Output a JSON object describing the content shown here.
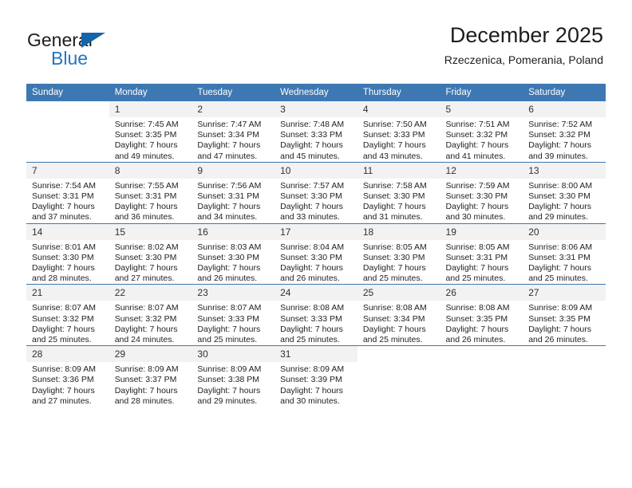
{
  "brand": {
    "name_part1": "General",
    "name_part2": "Blue",
    "triangle_color": "#1464aa",
    "blue_color": "#1f77c4"
  },
  "header": {
    "title": "December 2025",
    "subtitle": "Rzeczenica, Pomerania, Poland"
  },
  "theme": {
    "header_bg": "#3d78b2",
    "daynum_bg": "#f2f2f2",
    "text": "#222222"
  },
  "weekday_headers": [
    "Sunday",
    "Monday",
    "Tuesday",
    "Wednesday",
    "Thursday",
    "Friday",
    "Saturday"
  ],
  "weeks": [
    {
      "days": [
        {
          "num": "",
          "sunrise": "",
          "sunset": "",
          "daylight1": "",
          "daylight2": ""
        },
        {
          "num": "1",
          "sunrise": "Sunrise: 7:45 AM",
          "sunset": "Sunset: 3:35 PM",
          "daylight1": "Daylight: 7 hours",
          "daylight2": "and 49 minutes."
        },
        {
          "num": "2",
          "sunrise": "Sunrise: 7:47 AM",
          "sunset": "Sunset: 3:34 PM",
          "daylight1": "Daylight: 7 hours",
          "daylight2": "and 47 minutes."
        },
        {
          "num": "3",
          "sunrise": "Sunrise: 7:48 AM",
          "sunset": "Sunset: 3:33 PM",
          "daylight1": "Daylight: 7 hours",
          "daylight2": "and 45 minutes."
        },
        {
          "num": "4",
          "sunrise": "Sunrise: 7:50 AM",
          "sunset": "Sunset: 3:33 PM",
          "daylight1": "Daylight: 7 hours",
          "daylight2": "and 43 minutes."
        },
        {
          "num": "5",
          "sunrise": "Sunrise: 7:51 AM",
          "sunset": "Sunset: 3:32 PM",
          "daylight1": "Daylight: 7 hours",
          "daylight2": "and 41 minutes."
        },
        {
          "num": "6",
          "sunrise": "Sunrise: 7:52 AM",
          "sunset": "Sunset: 3:32 PM",
          "daylight1": "Daylight: 7 hours",
          "daylight2": "and 39 minutes."
        }
      ]
    },
    {
      "days": [
        {
          "num": "7",
          "sunrise": "Sunrise: 7:54 AM",
          "sunset": "Sunset: 3:31 PM",
          "daylight1": "Daylight: 7 hours",
          "daylight2": "and 37 minutes."
        },
        {
          "num": "8",
          "sunrise": "Sunrise: 7:55 AM",
          "sunset": "Sunset: 3:31 PM",
          "daylight1": "Daylight: 7 hours",
          "daylight2": "and 36 minutes."
        },
        {
          "num": "9",
          "sunrise": "Sunrise: 7:56 AM",
          "sunset": "Sunset: 3:31 PM",
          "daylight1": "Daylight: 7 hours",
          "daylight2": "and 34 minutes."
        },
        {
          "num": "10",
          "sunrise": "Sunrise: 7:57 AM",
          "sunset": "Sunset: 3:30 PM",
          "daylight1": "Daylight: 7 hours",
          "daylight2": "and 33 minutes."
        },
        {
          "num": "11",
          "sunrise": "Sunrise: 7:58 AM",
          "sunset": "Sunset: 3:30 PM",
          "daylight1": "Daylight: 7 hours",
          "daylight2": "and 31 minutes."
        },
        {
          "num": "12",
          "sunrise": "Sunrise: 7:59 AM",
          "sunset": "Sunset: 3:30 PM",
          "daylight1": "Daylight: 7 hours",
          "daylight2": "and 30 minutes."
        },
        {
          "num": "13",
          "sunrise": "Sunrise: 8:00 AM",
          "sunset": "Sunset: 3:30 PM",
          "daylight1": "Daylight: 7 hours",
          "daylight2": "and 29 minutes."
        }
      ]
    },
    {
      "days": [
        {
          "num": "14",
          "sunrise": "Sunrise: 8:01 AM",
          "sunset": "Sunset: 3:30 PM",
          "daylight1": "Daylight: 7 hours",
          "daylight2": "and 28 minutes."
        },
        {
          "num": "15",
          "sunrise": "Sunrise: 8:02 AM",
          "sunset": "Sunset: 3:30 PM",
          "daylight1": "Daylight: 7 hours",
          "daylight2": "and 27 minutes."
        },
        {
          "num": "16",
          "sunrise": "Sunrise: 8:03 AM",
          "sunset": "Sunset: 3:30 PM",
          "daylight1": "Daylight: 7 hours",
          "daylight2": "and 26 minutes."
        },
        {
          "num": "17",
          "sunrise": "Sunrise: 8:04 AM",
          "sunset": "Sunset: 3:30 PM",
          "daylight1": "Daylight: 7 hours",
          "daylight2": "and 26 minutes."
        },
        {
          "num": "18",
          "sunrise": "Sunrise: 8:05 AM",
          "sunset": "Sunset: 3:30 PM",
          "daylight1": "Daylight: 7 hours",
          "daylight2": "and 25 minutes."
        },
        {
          "num": "19",
          "sunrise": "Sunrise: 8:05 AM",
          "sunset": "Sunset: 3:31 PM",
          "daylight1": "Daylight: 7 hours",
          "daylight2": "and 25 minutes."
        },
        {
          "num": "20",
          "sunrise": "Sunrise: 8:06 AM",
          "sunset": "Sunset: 3:31 PM",
          "daylight1": "Daylight: 7 hours",
          "daylight2": "and 25 minutes."
        }
      ]
    },
    {
      "days": [
        {
          "num": "21",
          "sunrise": "Sunrise: 8:07 AM",
          "sunset": "Sunset: 3:32 PM",
          "daylight1": "Daylight: 7 hours",
          "daylight2": "and 25 minutes."
        },
        {
          "num": "22",
          "sunrise": "Sunrise: 8:07 AM",
          "sunset": "Sunset: 3:32 PM",
          "daylight1": "Daylight: 7 hours",
          "daylight2": "and 24 minutes."
        },
        {
          "num": "23",
          "sunrise": "Sunrise: 8:07 AM",
          "sunset": "Sunset: 3:33 PM",
          "daylight1": "Daylight: 7 hours",
          "daylight2": "and 25 minutes."
        },
        {
          "num": "24",
          "sunrise": "Sunrise: 8:08 AM",
          "sunset": "Sunset: 3:33 PM",
          "daylight1": "Daylight: 7 hours",
          "daylight2": "and 25 minutes."
        },
        {
          "num": "25",
          "sunrise": "Sunrise: 8:08 AM",
          "sunset": "Sunset: 3:34 PM",
          "daylight1": "Daylight: 7 hours",
          "daylight2": "and 25 minutes."
        },
        {
          "num": "26",
          "sunrise": "Sunrise: 8:08 AM",
          "sunset": "Sunset: 3:35 PM",
          "daylight1": "Daylight: 7 hours",
          "daylight2": "and 26 minutes."
        },
        {
          "num": "27",
          "sunrise": "Sunrise: 8:09 AM",
          "sunset": "Sunset: 3:35 PM",
          "daylight1": "Daylight: 7 hours",
          "daylight2": "and 26 minutes."
        }
      ]
    },
    {
      "days": [
        {
          "num": "28",
          "sunrise": "Sunrise: 8:09 AM",
          "sunset": "Sunset: 3:36 PM",
          "daylight1": "Daylight: 7 hours",
          "daylight2": "and 27 minutes."
        },
        {
          "num": "29",
          "sunrise": "Sunrise: 8:09 AM",
          "sunset": "Sunset: 3:37 PM",
          "daylight1": "Daylight: 7 hours",
          "daylight2": "and 28 minutes."
        },
        {
          "num": "30",
          "sunrise": "Sunrise: 8:09 AM",
          "sunset": "Sunset: 3:38 PM",
          "daylight1": "Daylight: 7 hours",
          "daylight2": "and 29 minutes."
        },
        {
          "num": "31",
          "sunrise": "Sunrise: 8:09 AM",
          "sunset": "Sunset: 3:39 PM",
          "daylight1": "Daylight: 7 hours",
          "daylight2": "and 30 minutes."
        },
        {
          "num": "",
          "sunrise": "",
          "sunset": "",
          "daylight1": "",
          "daylight2": ""
        },
        {
          "num": "",
          "sunrise": "",
          "sunset": "",
          "daylight1": "",
          "daylight2": ""
        },
        {
          "num": "",
          "sunrise": "",
          "sunset": "",
          "daylight1": "",
          "daylight2": ""
        }
      ]
    }
  ]
}
